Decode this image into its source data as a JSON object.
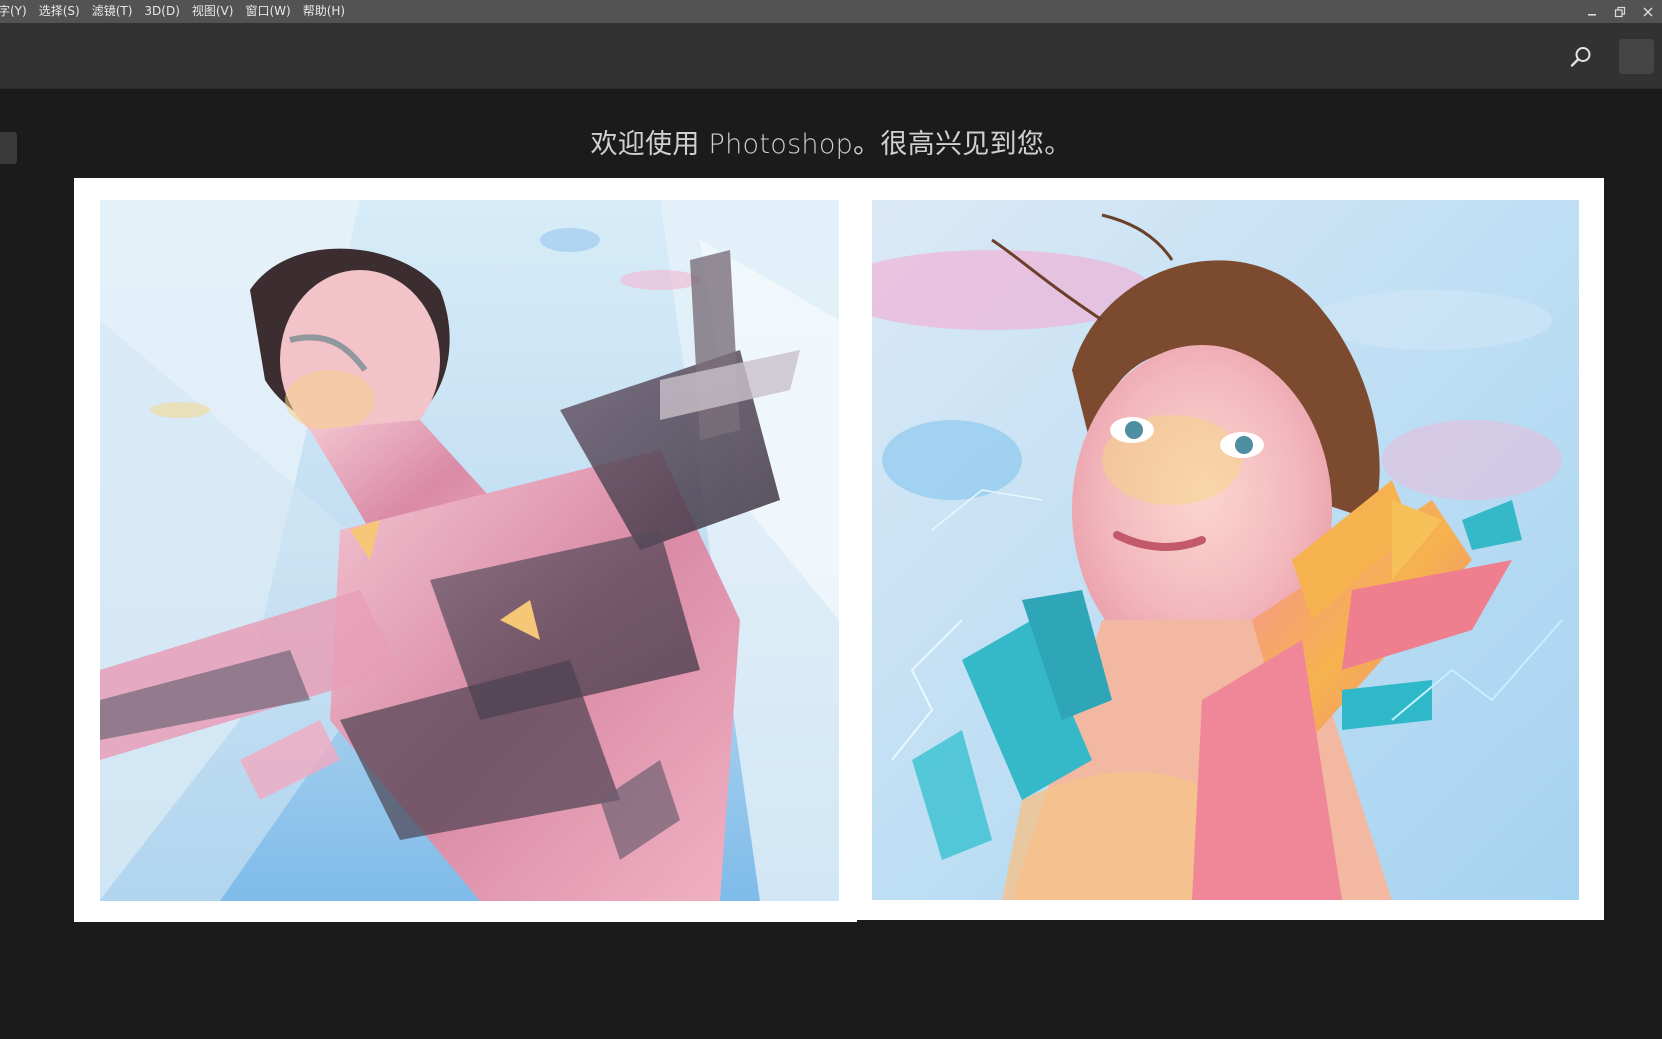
{
  "menubar": {
    "items": [
      {
        "label": "字(Y)"
      },
      {
        "label": "选择(S)"
      },
      {
        "label": "滤镜(T)"
      },
      {
        "label": "3D(D)"
      },
      {
        "label": "视图(V)"
      },
      {
        "label": "窗口(W)"
      },
      {
        "label": "帮助(H)"
      }
    ]
  },
  "window_controls": {
    "minimize": "minimize-icon",
    "restore": "restore-icon",
    "close": "close-icon"
  },
  "topbar": {
    "search_icon": "search-icon"
  },
  "welcome": {
    "title": "欢迎使用 Photoshop。很高兴见到您。"
  },
  "showcase": {
    "left_image": "artwork-woman-looking-up",
    "right_image": "artwork-woman-portrait"
  },
  "colors": {
    "menubar_bg": "#535353",
    "topbar_bg": "#323232",
    "workspace_bg": "#1b1b1b",
    "card_bg": "#ffffff",
    "sky_blue": "#9fd2f0",
    "pink": "#f4a3c0",
    "orange": "#f6b34a",
    "teal": "#35b9c9"
  }
}
